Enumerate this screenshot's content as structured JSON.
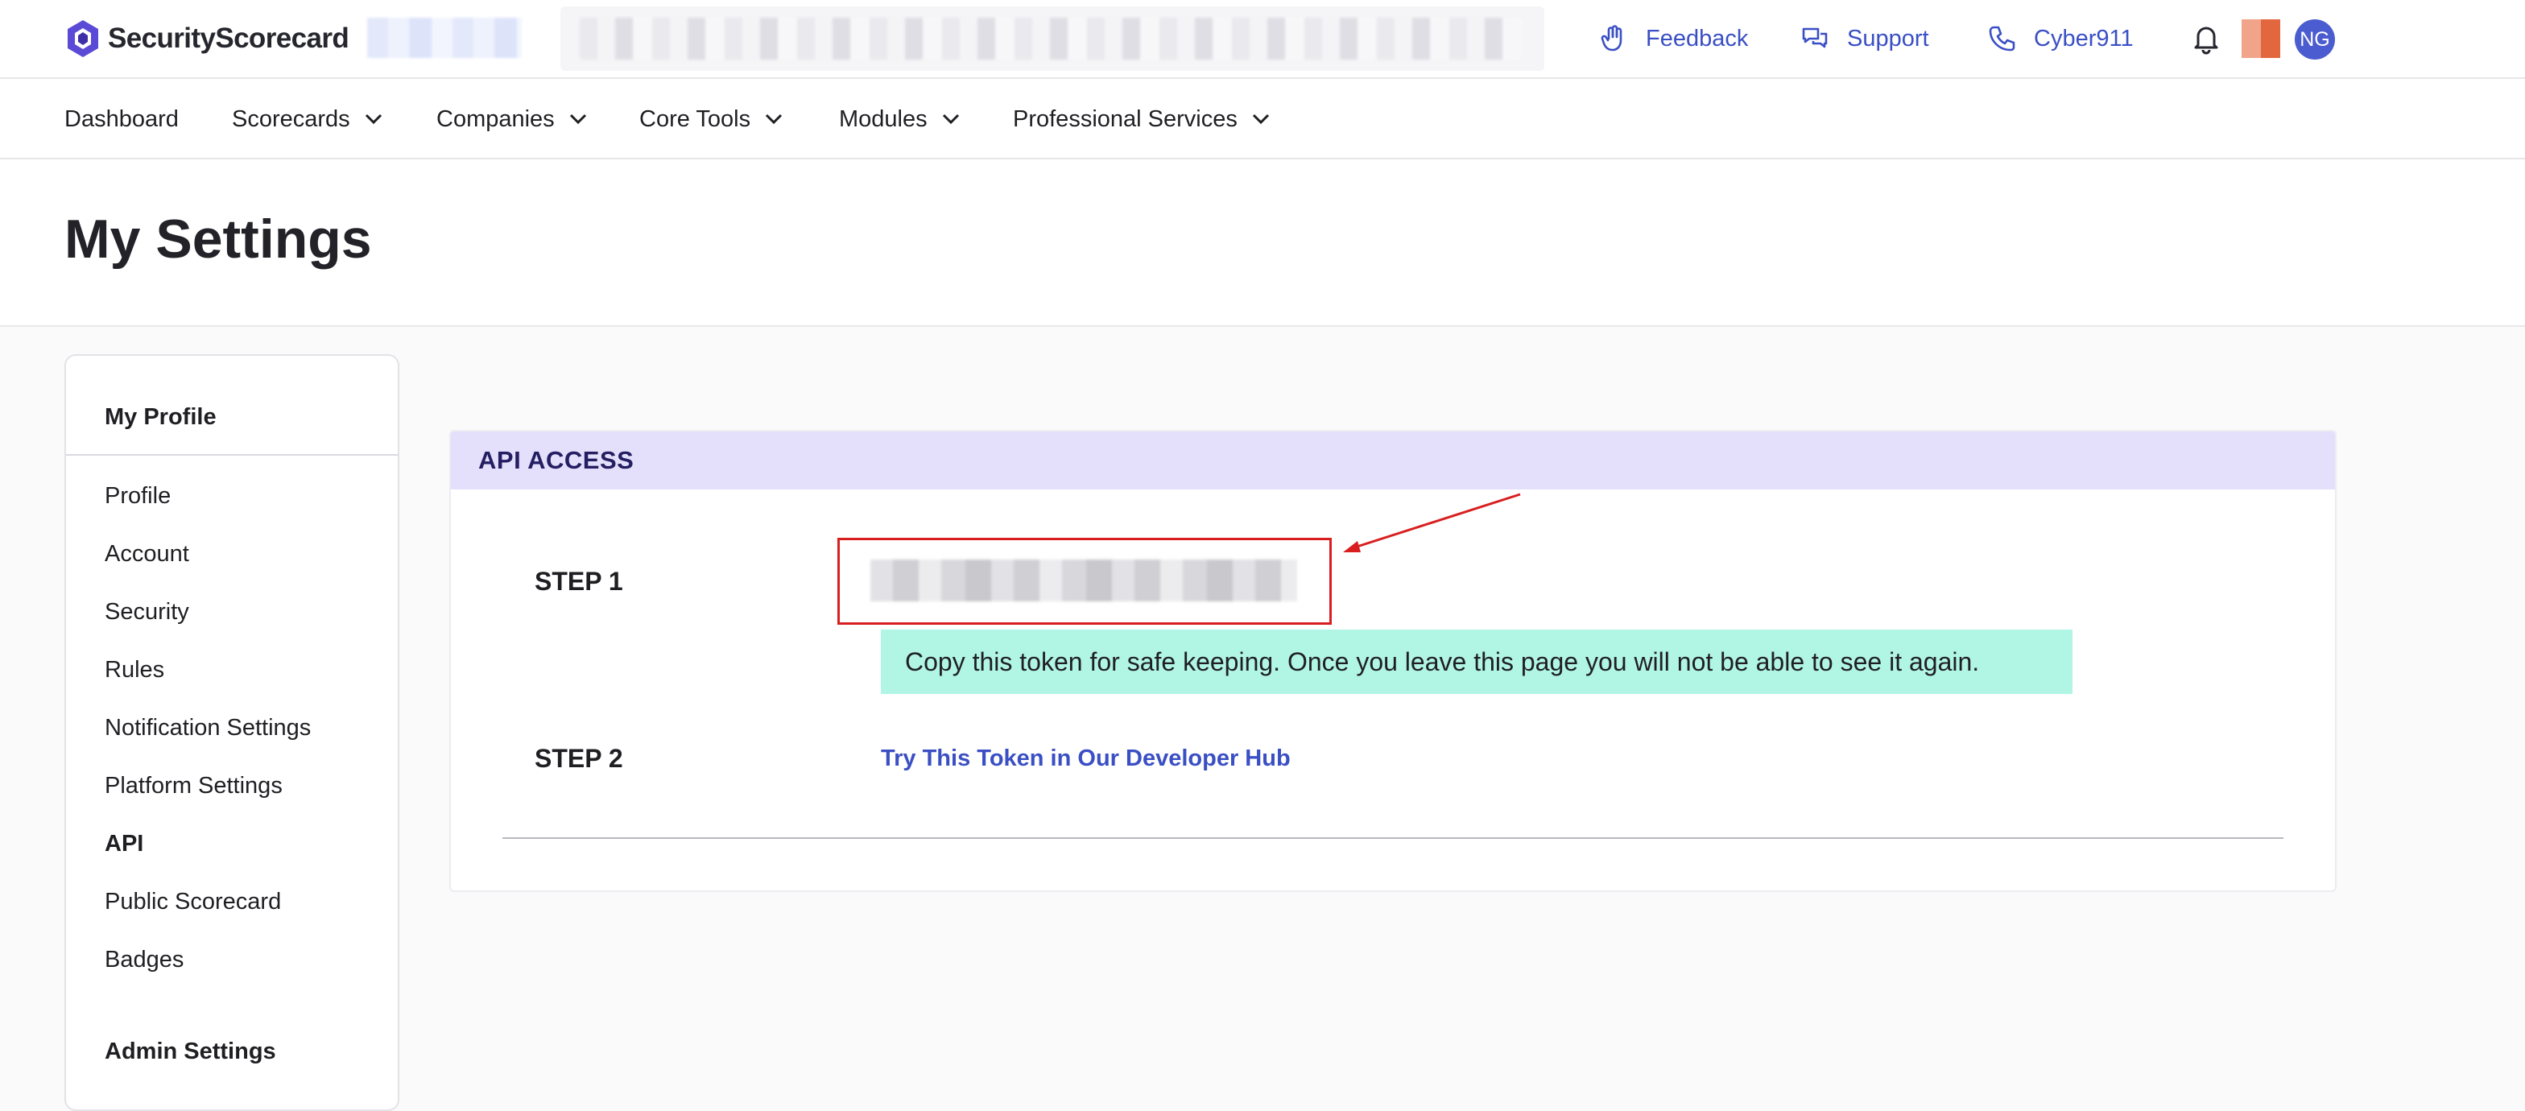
{
  "brand": {
    "name": "SecurityScorecard"
  },
  "topbar": {
    "feedback": "Feedback",
    "support": "Support",
    "cyber911": "Cyber911",
    "user_initials": "NG"
  },
  "nav": {
    "items": [
      {
        "label": "Dashboard"
      },
      {
        "label": "Scorecards"
      },
      {
        "label": "Companies"
      },
      {
        "label": "Core Tools"
      },
      {
        "label": "Modules"
      },
      {
        "label": "Professional Services"
      }
    ]
  },
  "page": {
    "title": "My Settings"
  },
  "sidebar": {
    "section_profile": "My Profile",
    "items": [
      {
        "label": "Profile"
      },
      {
        "label": "Account"
      },
      {
        "label": "Security"
      },
      {
        "label": "Rules"
      },
      {
        "label": "Notification Settings"
      },
      {
        "label": "Platform Settings"
      },
      {
        "label": "API"
      },
      {
        "label": "Public Scorecard"
      },
      {
        "label": "Badges"
      }
    ],
    "section_admin": "Admin Settings"
  },
  "api_access": {
    "title": "API ACCESS",
    "step1": "STEP 1",
    "step2": "STEP 2",
    "hint": "Copy this token for safe keeping. Once you leave this page you will not be able to see it again.",
    "developer_link": "Try This Token in Our Developer Hub"
  },
  "colors": {
    "accent": "#3a4fc4",
    "card_header": "#e4e0fb",
    "hint_background": "#b1f5e5",
    "highlight_border": "#d81e1e"
  }
}
